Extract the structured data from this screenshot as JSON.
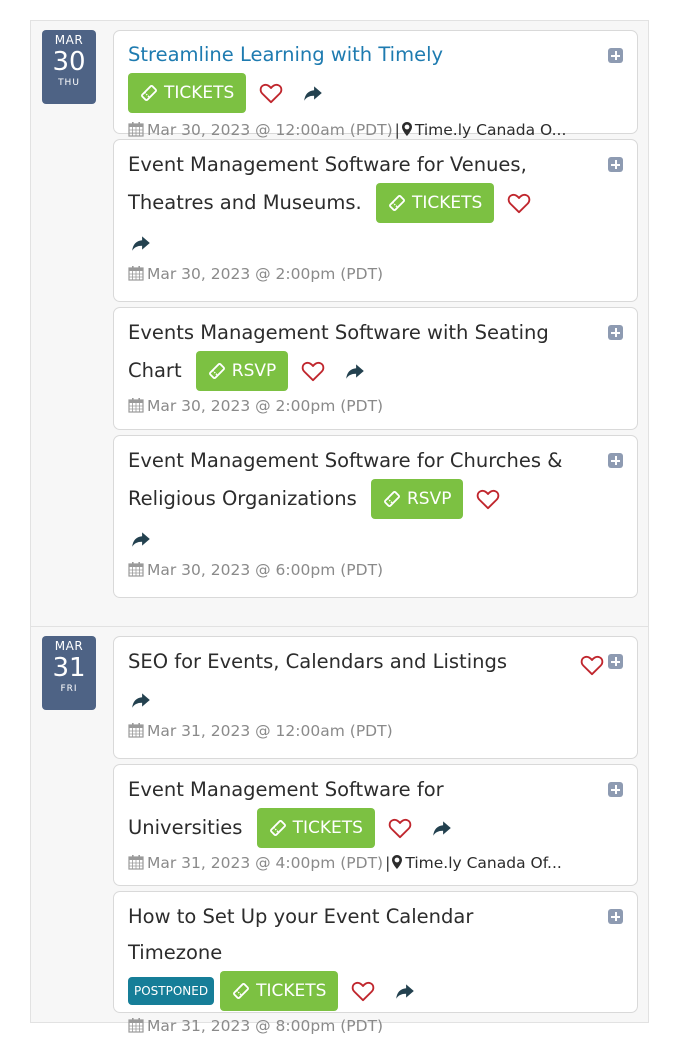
{
  "colors": {
    "date_badge": "#4e6385",
    "tickets_green": "#7cc142",
    "postponed_teal": "#167e98",
    "heart_red": "#c0262d",
    "title_link_blue": "#1e7bb0",
    "share_dark": "#23414f",
    "plus_gray": "#8e9bb2"
  },
  "days": [
    {
      "month": "MAR",
      "day": "30",
      "weekday": "THU",
      "events": [
        {
          "title": "Streamline Learning with Timely",
          "button": "TICKETS",
          "datetime": "Mar 30, 2023 @ 12:00am",
          "tz": "(PDT)",
          "venue": "Time.ly Canada O..."
        },
        {
          "title": "Event Management Software for Venues, Theatres and Museums.",
          "button": "TICKETS",
          "datetime": "Mar 30, 2023 @ 2:00pm",
          "tz": "(PDT)"
        },
        {
          "title": "Events Management Software with Seating Chart",
          "button": "RSVP",
          "datetime": "Mar 30, 2023 @ 2:00pm",
          "tz": "(PDT)"
        },
        {
          "title": "Event Management Software for Churches & Religious Organizations",
          "button": "RSVP",
          "datetime": "Mar 30, 2023 @ 6:00pm",
          "tz": "(PDT)"
        }
      ]
    },
    {
      "month": "MAR",
      "day": "31",
      "weekday": "FRI",
      "events": [
        {
          "title": "SEO for Events, Calendars and Listings",
          "datetime": "Mar 31, 2023 @ 12:00am",
          "tz": "(PDT)"
        },
        {
          "title": "Event Management Software for Universities",
          "button": "TICKETS",
          "datetime": "Mar 31, 2023 @ 4:00pm",
          "tz": "(PDT)",
          "venue": "Time.ly Canada Of..."
        },
        {
          "title": "How to Set Up your Event Calendar Timezone",
          "status": "POSTPONED",
          "button": "TICKETS",
          "datetime": "Mar 31, 2023 @ 8:00pm",
          "tz": "(PDT)"
        }
      ]
    }
  ],
  "icons": {
    "ticket": "ticket-icon",
    "heart": "heart-outline-icon",
    "share": "share-arrow-icon",
    "plus": "plus-square-icon",
    "calendar": "calendar-icon",
    "map_marker": "map-marker-icon"
  }
}
